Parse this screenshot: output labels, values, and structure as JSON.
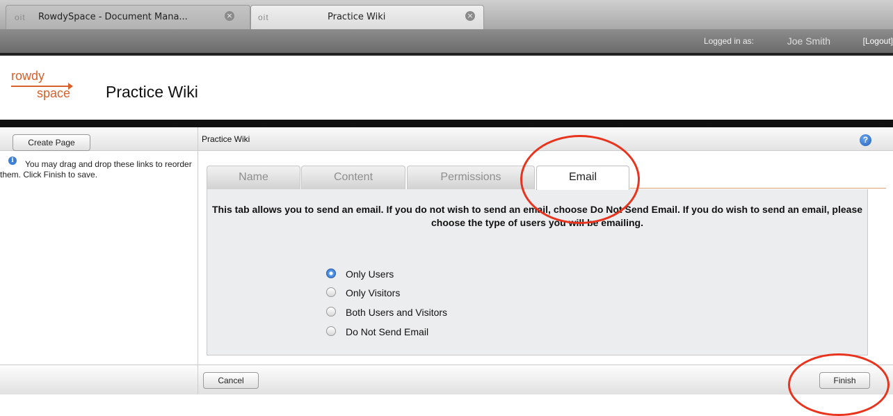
{
  "browser": {
    "tabs": [
      {
        "logo": "oit",
        "title": "RowdySpace - Document Mana...",
        "close": "×"
      },
      {
        "logo": "oit",
        "title": "Practice Wiki",
        "close": "×"
      }
    ]
  },
  "session": {
    "logged_in_label": "Logged in as:",
    "user": "Joe Smith",
    "logout": "[Logout]"
  },
  "header": {
    "logo_top": "rowdy",
    "logo_bottom": "space",
    "title": "Practice Wiki"
  },
  "sidebar": {
    "create_button": "Create Page",
    "info_icon": "i",
    "hint": "You may drag and drop these links to reorder them. Click Finish to save."
  },
  "main": {
    "title": "Practice Wiki",
    "help_icon": "?",
    "tabs": [
      {
        "label": "Name"
      },
      {
        "label": "Content"
      },
      {
        "label": "Permissions"
      },
      {
        "label": "Email"
      }
    ],
    "description": "This tab allows you to send an email. If you do not wish to send an email, choose Do Not Send Email. If you do wish to send an email, please choose the type of users you will be emailing.",
    "options": [
      {
        "label": "Only Users",
        "selected": true
      },
      {
        "label": "Only Visitors",
        "selected": false
      },
      {
        "label": "Both Users and Visitors",
        "selected": false
      },
      {
        "label": "Do Not Send Email",
        "selected": false
      }
    ]
  },
  "footer": {
    "cancel": "Cancel",
    "finish": "Finish"
  },
  "colors": {
    "brand_orange": "#d8602a",
    "annotation_red": "#e8331d",
    "radio_selected": "#2c6fd0"
  }
}
